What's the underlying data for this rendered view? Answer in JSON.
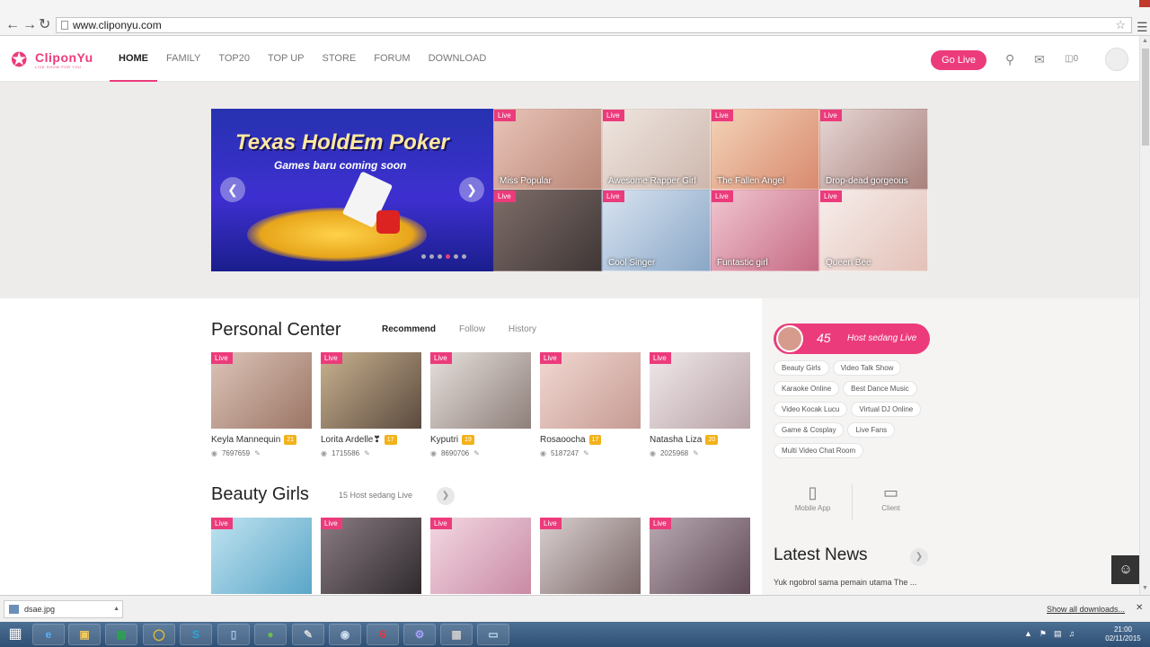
{
  "browser": {
    "url": "www.cliponyu.com"
  },
  "site": {
    "logo_name": "CliponYu",
    "logo_tagline": "LIVE SHOW FOR YOU",
    "nav": [
      "HOME",
      "FAMILY",
      "TOP20",
      "TOP UP",
      "STORE",
      "FORUM",
      "DOWNLOAD"
    ],
    "active_nav": "HOME",
    "golive_label": "Go Live",
    "gift_count": "0"
  },
  "hero": {
    "banner_title": "Texas HoldEm Poker",
    "banner_subtitle": "Games baru coming soon",
    "slide_count": 6,
    "active_slide": 4,
    "tiles": [
      {
        "live": "Live",
        "caption": "Miss Popular"
      },
      {
        "live": "Live",
        "caption": "Awesome Rapper Girl"
      },
      {
        "live": "Live",
        "caption": "The Fallen Angel"
      },
      {
        "live": "Live",
        "caption": "Drop-dead gorgeous"
      },
      {
        "live": "Live",
        "caption": ""
      },
      {
        "live": "Live",
        "caption": "Cool Singer"
      },
      {
        "live": "Live",
        "caption": "Funtastic girl"
      },
      {
        "live": "Live",
        "caption": "Queen Bee"
      }
    ]
  },
  "personal_center": {
    "title": "Personal Center",
    "tabs": [
      "Recommend",
      "Follow",
      "History"
    ],
    "active_tab": "Recommend",
    "cards": [
      {
        "live": "Live",
        "name": "Keyla Mannequin",
        "badge": "21",
        "views": "7697659"
      },
      {
        "live": "Live",
        "name": "Lorita Ardelle❣",
        "badge": "17",
        "views": "1715586"
      },
      {
        "live": "Live",
        "name": "Kyputri",
        "badge": "19",
        "views": "8690706"
      },
      {
        "live": "Live",
        "name": "Rosaoocha",
        "badge": "17",
        "views": "5187247"
      },
      {
        "live": "Live",
        "name": "Natasha Liza",
        "badge": "20",
        "views": "2025968"
      }
    ]
  },
  "beauty_girls": {
    "title": "Beauty Girls",
    "subtitle": "15  Host sedang Live",
    "cards": [
      {
        "live": "Live"
      },
      {
        "live": "Live"
      },
      {
        "live": "Live"
      },
      {
        "live": "Live"
      },
      {
        "live": "Live"
      }
    ]
  },
  "sidebar": {
    "host_count": "45",
    "host_label": "Host sedang Live",
    "categories": [
      "Beauty Girls",
      "Video Talk Show",
      "Karaoke Online",
      "Best Dance Music",
      "Video Kocak Lucu",
      "Virtual DJ Online",
      "Game & Cosplay",
      "Live Fans",
      "Multi Video Chat Room"
    ],
    "apps": [
      "Mobile App",
      "Client"
    ],
    "news_title": "Latest News",
    "news_item": "Yuk ngobrol sama pemain utama The ..."
  },
  "downloads": {
    "file": "dsae.jpg",
    "show_all": "Show all downloads..."
  },
  "taskbar": {
    "time": "21:00",
    "date": "02/11/2015"
  },
  "colors": {
    "brand": "#ec3b7b",
    "badge": "#f2b21a"
  }
}
